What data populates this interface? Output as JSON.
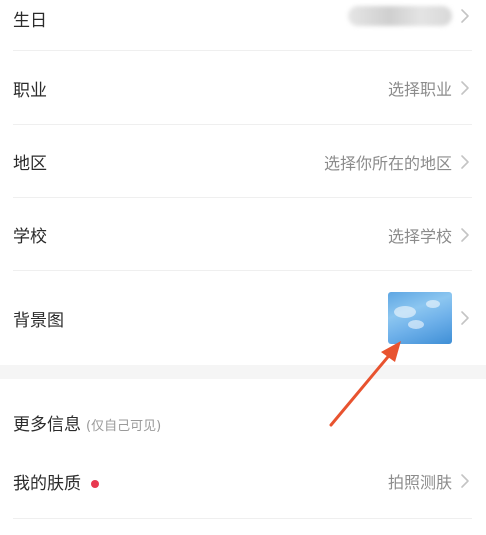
{
  "profile_rows": [
    {
      "label": "生日",
      "value": ""
    },
    {
      "label": "职业",
      "value": "选择职业"
    },
    {
      "label": "地区",
      "value": "选择你所在的地区"
    },
    {
      "label": "学校",
      "value": "选择学校"
    },
    {
      "label": "背景图",
      "value": ""
    }
  ],
  "more_info": {
    "title": "更多信息",
    "subtitle": "(仅自己可见)"
  },
  "skin_row": {
    "label": "我的肤质",
    "value": "拍照测肤"
  },
  "colors": {
    "accent_red": "#e8384f",
    "annotation_arrow": "#e8532f",
    "secondary_text": "#8c8c8c"
  },
  "icons": [
    "chevron-right-icon",
    "notification-dot",
    "annotation-arrow"
  ]
}
